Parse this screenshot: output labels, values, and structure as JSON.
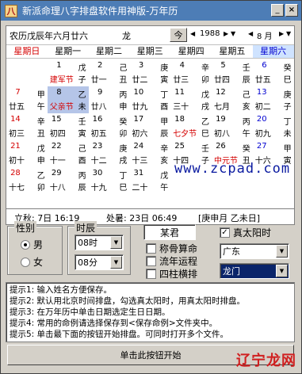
{
  "window": {
    "title": "新派命理八字排盘软件用神版-万年历",
    "icon_char": "八",
    "minimize": "_",
    "close": "×"
  },
  "calendar_header": {
    "lunar_date": "农历戊辰年六月廿六",
    "zodiac": "龙",
    "today_label": "今",
    "year": "1988",
    "month": "8 月"
  },
  "week_days": [
    "星期日",
    "星期一",
    "星期二",
    "星期三",
    "星期四",
    "星期五",
    "星期六"
  ],
  "days": [
    {
      "col": 1,
      "row": 0,
      "d": "1",
      "gz1": "戊",
      "lu": "建军节",
      "gz2": "子",
      "fest": true
    },
    {
      "col": 2,
      "row": 0,
      "d": "2",
      "gz1": "己",
      "lu": "廿一",
      "gz2": "丑"
    },
    {
      "col": 3,
      "row": 0,
      "d": "3",
      "gz1": "庚",
      "lu": "廿二",
      "gz2": "寅"
    },
    {
      "col": 4,
      "row": 0,
      "d": "4",
      "gz1": "辛",
      "lu": "廿三",
      "gz2": "卯"
    },
    {
      "col": 5,
      "row": 0,
      "d": "5",
      "gz1": "壬",
      "lu": "廿四",
      "gz2": "辰"
    },
    {
      "col": 6,
      "row": 0,
      "d": "6",
      "gz1": "癸",
      "lu": "廿五",
      "gz2": "巳"
    },
    {
      "col": 0,
      "row": 1,
      "d": "7",
      "gz1": "甲",
      "lu": "廿五",
      "gz2": "午"
    },
    {
      "col": 1,
      "row": 1,
      "d": "8",
      "gz1": "乙",
      "lu": "父亲节",
      "gz2": "未",
      "sel": true
    },
    {
      "col": 2,
      "row": 1,
      "d": "9",
      "gz1": "丙",
      "lu": "廿八",
      "gz2": "申"
    },
    {
      "col": 3,
      "row": 1,
      "d": "10",
      "gz1": "丁",
      "lu": "廿九",
      "gz2": "酉"
    },
    {
      "col": 4,
      "row": 1,
      "d": "11",
      "gz1": "戊",
      "lu": "三十",
      "gz2": "戌"
    },
    {
      "col": 5,
      "row": 1,
      "d": "12",
      "gz1": "己",
      "lu": "七月",
      "gz2": "亥"
    },
    {
      "col": 6,
      "row": 1,
      "d": "13",
      "gz1": "庚",
      "lu": "初二",
      "gz2": "子"
    },
    {
      "col": 0,
      "row": 2,
      "d": "14",
      "gz1": "辛",
      "lu": "初三",
      "gz2": "丑"
    },
    {
      "col": 1,
      "row": 2,
      "d": "15",
      "gz1": "壬",
      "lu": "初四",
      "gz2": "寅"
    },
    {
      "col": 2,
      "row": 2,
      "d": "16",
      "gz1": "癸",
      "lu": "初五",
      "gz2": "卯"
    },
    {
      "col": 3,
      "row": 2,
      "d": "17",
      "gz1": "甲",
      "lu": "初六",
      "gz2": "辰"
    },
    {
      "col": 4,
      "row": 2,
      "d": "18",
      "gz1": "乙",
      "lu": "七夕节",
      "gz2": "巳",
      "fest": true
    },
    {
      "col": 5,
      "row": 2,
      "d": "19",
      "gz1": "丙",
      "lu": "初八",
      "gz2": "午"
    },
    {
      "col": 6,
      "row": 2,
      "d": "20",
      "gz1": "丁",
      "lu": "初九",
      "gz2": "未"
    },
    {
      "col": 0,
      "row": 3,
      "d": "21",
      "gz1": "戊",
      "lu": "初十",
      "gz2": "申"
    },
    {
      "col": 1,
      "row": 3,
      "d": "22",
      "gz1": "己",
      "lu": "十一",
      "gz2": "酉"
    },
    {
      "col": 2,
      "row": 3,
      "d": "23",
      "gz1": "庚",
      "lu": "十二",
      "gz2": "戌"
    },
    {
      "col": 3,
      "row": 3,
      "d": "24",
      "gz1": "辛",
      "lu": "十三",
      "gz2": "亥"
    },
    {
      "col": 4,
      "row": 3,
      "d": "25",
      "gz1": "壬",
      "lu": "十四",
      "gz2": "子"
    },
    {
      "col": 5,
      "row": 3,
      "d": "26",
      "gz1": "癸",
      "lu": "中元节",
      "gz2": "丑",
      "fest": true
    },
    {
      "col": 6,
      "row": 3,
      "d": "27",
      "gz1": "甲",
      "lu": "十六",
      "gz2": "寅"
    },
    {
      "col": 0,
      "row": 4,
      "d": "28",
      "gz1": "乙",
      "lu": "十七",
      "gz2": "卯"
    },
    {
      "col": 1,
      "row": 4,
      "d": "29",
      "gz1": "丙",
      "lu": "十八",
      "gz2": "辰"
    },
    {
      "col": 2,
      "row": 4,
      "d": "30",
      "gz1": "丁",
      "lu": "十九",
      "gz2": "巳"
    },
    {
      "col": 3,
      "row": 4,
      "d": "31",
      "gz1": "戊",
      "lu": "二十",
      "gz2": "午"
    }
  ],
  "watermark": "www.zcpad.com",
  "info_bar": {
    "liqiu": "立秋: 7日 16:19",
    "chushu": "处暑: 23日 06:49",
    "ganzhi": "[庚申月 乙未日]"
  },
  "gender": {
    "label": "性别",
    "male": "男",
    "female": "女",
    "selected": "male"
  },
  "time": {
    "label": "时辰",
    "hour": "08时",
    "minute": "08分"
  },
  "name_value": "某君",
  "options": {
    "true_solar_time": "真太阳时",
    "chenggu": "称骨算命",
    "liunian": "流年运程",
    "sizhu": "四柱横排"
  },
  "location": {
    "province": "广东",
    "city": "龙门"
  },
  "tips": [
    "提示1: 输入姓名方便保存。",
    "提示2: 默认用北京时间排盘，勾选真太阳时，用真太阳时排盘。",
    "提示3: 在万年历中单击日期选定生日日期。",
    "提示4: 常用的命例请选择保存到<保存命例>文件夹中。",
    "提示5: 单击最下面的按钮开始排盘。可同时打开多个文件。"
  ],
  "start_button": "单击此按钮开始",
  "logo": "辽宁龙网"
}
